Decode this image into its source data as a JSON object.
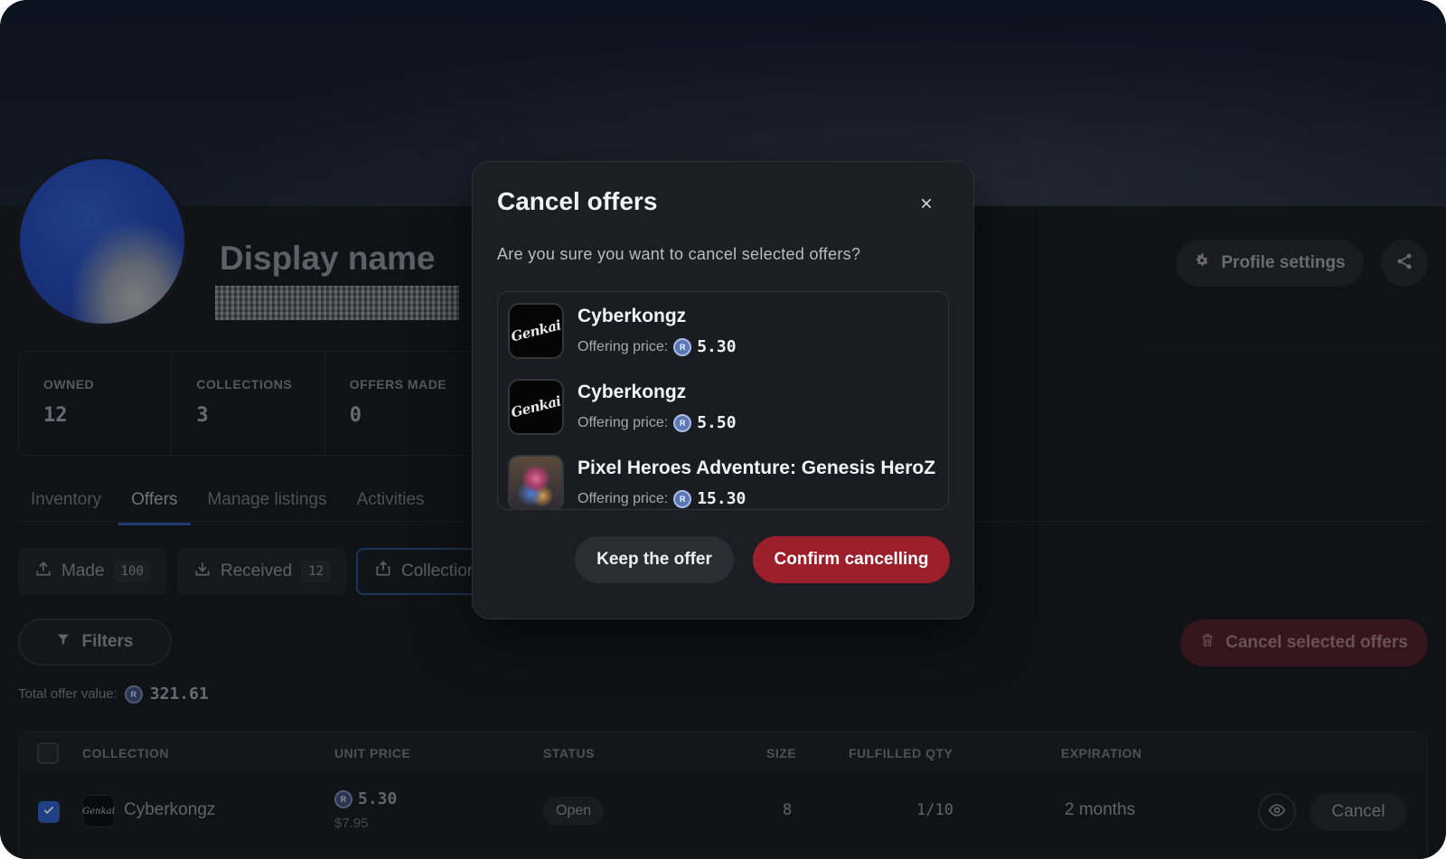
{
  "profile": {
    "display_name": "Display name",
    "settings_label": "Profile settings"
  },
  "stats": [
    {
      "label": "OWNED",
      "value": "12"
    },
    {
      "label": "COLLECTIONS",
      "value": "3"
    },
    {
      "label": "OFFERS MADE",
      "value": "0"
    }
  ],
  "tabs": [
    {
      "label": "Inventory",
      "active": false
    },
    {
      "label": "Offers",
      "active": true
    },
    {
      "label": "Manage listings",
      "active": false
    },
    {
      "label": "Activities",
      "active": false
    }
  ],
  "subtabs": [
    {
      "label": "Made",
      "count": "100"
    },
    {
      "label": "Received",
      "count": "12"
    },
    {
      "label": "Collection"
    }
  ],
  "filters_label": "Filters",
  "cancel_selected_label": "Cancel selected offers",
  "total": {
    "label": "Total offer value:",
    "value": "321.61"
  },
  "table": {
    "columns": [
      "COLLECTION",
      "UNIT PRICE",
      "STATUS",
      "SIZE",
      "FULFILLED QTY",
      "EXPIRATION"
    ],
    "rows": [
      {
        "logo_text": "Genkai",
        "collection": "Cyberkongz",
        "unit_price": "5.30",
        "unit_price_usd": "$7.95",
        "status": "Open",
        "size": "8",
        "fulfilled": "1/10",
        "expiration": "2 months",
        "cancel_label": "Cancel",
        "checked": true
      }
    ]
  },
  "modal": {
    "title": "Cancel offers",
    "description": "Are you sure you want to cancel selected offers?",
    "price_label": "Offering price:",
    "offers": [
      {
        "thumb_text": "Genkai",
        "name": "Cyberkongz",
        "price": "5.30"
      },
      {
        "thumb_text": "Genkai",
        "name": "Cyberkongz",
        "price": "5.50"
      },
      {
        "name": "Pixel Heroes Adventure: Genesis HeroZ",
        "price": "15.30"
      }
    ],
    "keep_label": "Keep the offer",
    "confirm_label": "Confirm cancelling"
  },
  "colors": {
    "accent": "#2d58a8",
    "danger": "#9a1f2b",
    "background": "#16181d"
  }
}
